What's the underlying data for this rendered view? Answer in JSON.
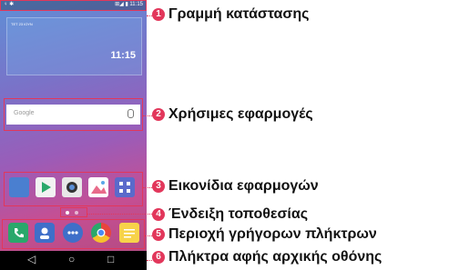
{
  "screen": {
    "status_left": "♀ ✱",
    "status_right": "⊞◢ ▮ 11:15",
    "clock_date": "ΤΕΤ 23 ΙΟΥΝ",
    "clock_time": "11:15",
    "search_placeholder": "Google",
    "nav_back": "◁",
    "nav_home": "○",
    "nav_recent": "□"
  },
  "callouts": [
    {
      "number": "1",
      "label": "Γραμμή κατάστασης"
    },
    {
      "number": "2",
      "label": "Χρήσιμες εφαρμογές"
    },
    {
      "number": "3",
      "label": "Εικονίδια εφαρμογών"
    },
    {
      "number": "4",
      "label": "Ένδειξη τοποθεσίας"
    },
    {
      "number": "5",
      "label": "Περιοχή γρήγορων πλήκτρων"
    },
    {
      "number": "6",
      "label": "Πλήκτρα αφής αρχικής οθόνης"
    }
  ],
  "colors": {
    "accent": "#e2375b"
  }
}
